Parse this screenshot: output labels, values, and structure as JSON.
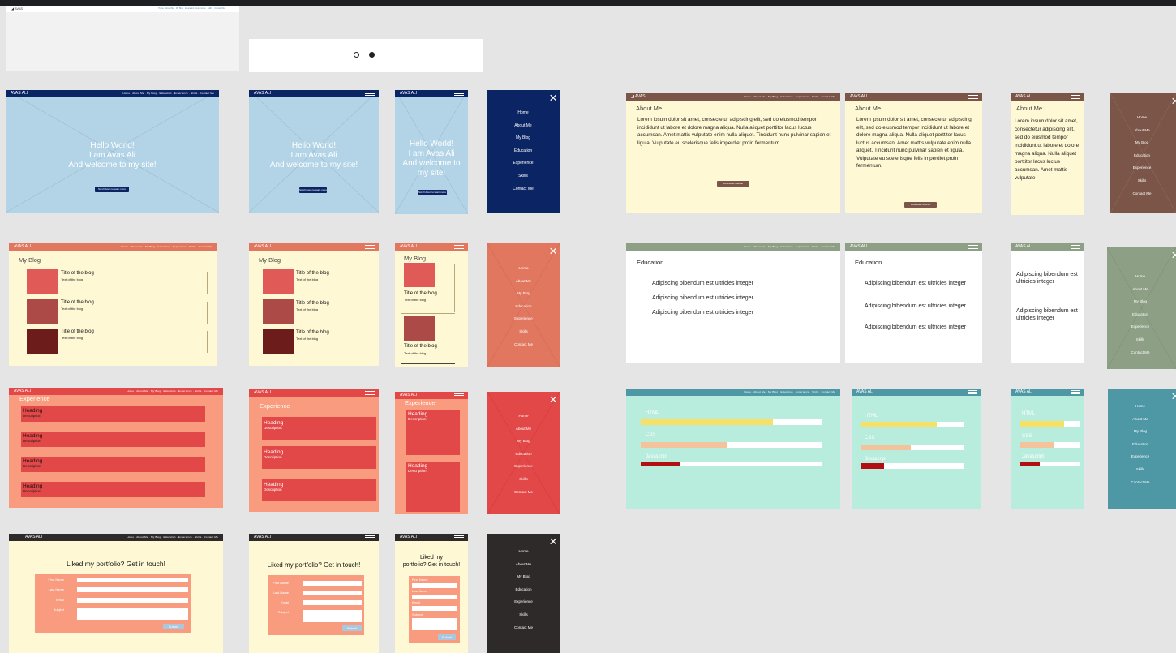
{
  "brand": "AVAS ALI",
  "nav_links": "Home  ·  About Me  ·  My Blog  ·  Education  ·  Experience  ·  Skills  ·  Contact Me",
  "menu_items": [
    "Home",
    "About Me",
    "My Blog",
    "Education",
    "Experience",
    "Skills",
    "Contact Me"
  ],
  "top": {
    "small_logo": "◢ AVAS"
  },
  "hero": {
    "line1": "Hello World!",
    "line2": "I am Avas Ali",
    "line3": "And welcome to my site!",
    "line3b": "And welcome to",
    "line3c": "my site!",
    "button": "Scroll down to learn more"
  },
  "about": {
    "title": "About Me",
    "text": "Lorem ipsum dolor sit amet, consectetur adipiscing elit, sed do eiusmod tempor incididunt ut labore et dolore magna aliqua. Nulla aliquet porttitor lacus luctus accumsan. Amet mattis vulputate enim nulla aliquet. Tincidunt nunc pulvinar sapien et ligula. Vulputate eu scelerisque felis imperdiet proin fermentum.",
    "text_mobile": "Lorem ipsum dolor sit amet, consectetur adipiscing elit, sed do eiusmod tempor incididunt ut labore et dolore magna aliqua. Nulla aliquet porttitor lacus luctus accumsan. Amet mattis vulputate",
    "button": "Download resume"
  },
  "blog": {
    "title": "My Blog",
    "post_title": "Title of the blog",
    "post_text": "Text of the blog"
  },
  "education": {
    "title": "Education",
    "item": "Adipiscing bibendum est ultricies integer"
  },
  "experience": {
    "title": "Experience",
    "heading": "Heading",
    "desc": "Description"
  },
  "skills": {
    "html": "HTML",
    "css": "CSS",
    "js": "Javascript"
  },
  "contact": {
    "title": "Liked my portfolio? Get in touch!",
    "title_l1": "Liked my",
    "title_l2": "portfolio? Get in touch!",
    "first": "First Name",
    "last": "Last Name",
    "email": "Email",
    "subject": "Subject",
    "submit": "Submit"
  },
  "colors": {
    "navy": "#0b2463",
    "sky": "#b3d4e6",
    "brown": "#7a5548",
    "cream": "#fff8d4",
    "salmon": "#e27760",
    "red": "#e24847",
    "sage": "#8d9f84",
    "mint": "#b8ecdd",
    "teal": "#4e97a5",
    "charcoal": "#2d2a29"
  },
  "skill_levels": {
    "html": 0.73,
    "css": 0.48,
    "js": 0.22,
    "mobile_html": 0.73,
    "mobile_css": 0.55,
    "mobile_js": 0.33
  },
  "icons": [
    "github-icon",
    "linkedin-icon",
    "close-icon",
    "hamburger-menu-icon"
  ]
}
